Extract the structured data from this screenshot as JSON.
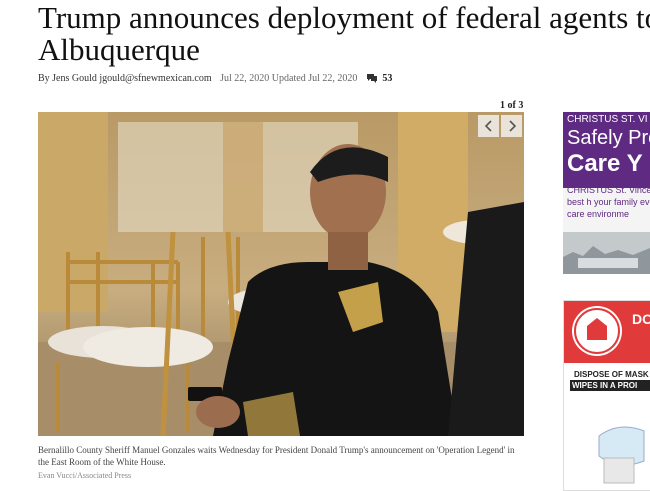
{
  "article": {
    "headline": "Trump announces deployment of federal agents to Albuquerque",
    "author": "By Jens Gould jgould@sfnewmexican.com",
    "dates": "Jul 22, 2020 Updated Jul 22, 2020",
    "comment_count": "53"
  },
  "gallery": {
    "counter": "1 of 3",
    "caption": "Bernalillo County Sheriff Manuel Gonzales waits Wednesday for President Donald Trump's announcement on 'Operation Legend' in the East Room of the White House.",
    "credit": "Evan Vucci/Associated Press"
  },
  "ads": {
    "ad1": {
      "brand": "CHRISTUS ST. VI",
      "line1": "Safely Pro",
      "line2": "Care Y",
      "body": "CHRISTUS St. Vince providing the best h your family every d safe care environme"
    },
    "ad2": {
      "heading": "DO",
      "line1": "DISPOSE OF MASK",
      "line2": "WIPES IN A PROI"
    }
  },
  "colors": {
    "ad1_purple": "#5f2a82",
    "ad2_red": "#e03a3a"
  }
}
